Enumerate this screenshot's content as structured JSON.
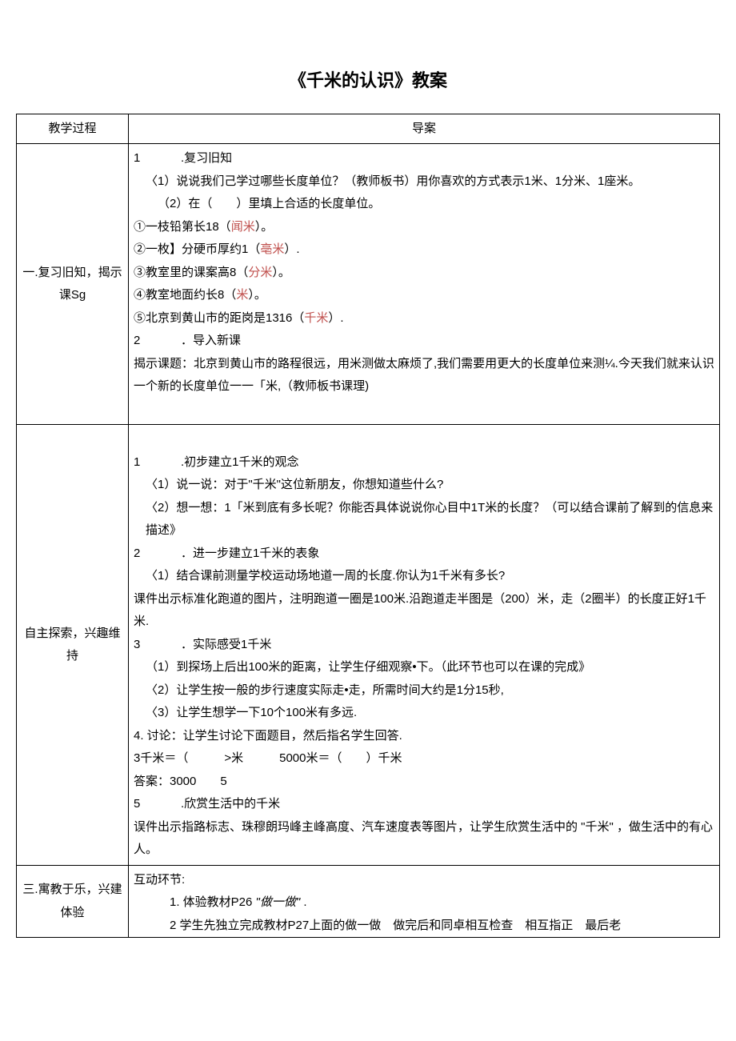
{
  "title": "《千米的认识》教案",
  "header": {
    "col1": "教学过程",
    "col2": "导案"
  },
  "rows": [
    {
      "label": "一.复习旧知，揭示课Sg",
      "content": {
        "s1_num": "1",
        "s1": ".复习旧知",
        "s1a": "〈1）说说我们己学过哪些长度单位？（教师板书）用你喜欢的方式表示1米、1分米、1座米。",
        "s1b": "（2）在（　　）里填上合适的长度单位。",
        "i1a": "①一枝铅第长18（",
        "i1u": "闻米",
        "i1b": "）。",
        "i2a": "②一枚】分硬币厚约1（",
        "i2u": "亳米",
        "i2b": "）.",
        "i3a": "③教室里的课案高8（",
        "i3u": "分米",
        "i3b": "）。",
        "i4a": "④教室地面约长8（",
        "i4u": "米",
        "i4b": "）。",
        "i5a": "⑤北京到黄山市的距岗是1316（",
        "i5u": "千米",
        "i5b": "）.",
        "s2_num": "2",
        "s2": "．导入新课",
        "s2a": "揭示课题：北京到黄山市的路程很远，用米测做太麻烦了,我们需要用更大的长度单位来测¼.今天我们就来认识一个新的长度单位一一「米,（教师板书课理)"
      }
    },
    {
      "label": "自主探索，兴趣维持",
      "content": {
        "s1_num": "1",
        "s1": ".初步建立1千米的观念",
        "s1a": "〈1）说一说：对于\"千米\"这位新朋友，你想知道些什么?",
        "s1b": "〈2）想一想：1「米到底有多长呢？你能否具体说说你心目中1T米的长度？（可以结合课前了解到的信息来描述》",
        "s2_num": "2",
        "s2": "．进一步建立1千米的表象",
        "s2a": "〈1）结合课前测量学校运动场地道一周的长度.你认为1千米有多长?",
        "s2b": "课件出示标准化跑道的图片，注明跑道一圈是100米.沿跑道走半图是（200）米，走（2圈半）的长度正好1千米.",
        "s3_num": "3",
        "s3": "．实际感受1千米",
        "s3a": "（1）到探场上后出100米的距离，让学生仔细观察•下。（此环节也可以在课的完成》",
        "s3b": "〈2）让学生按一般的步行速度实际走•走，所需时间大约是1分15秒,",
        "s3c": "〈3）让学生想学一下10个100米有多远.",
        "s4": "4. 讨论：让学生讨论下面题目，然后指名学生回答.",
        "s4a": "3千米＝（　　　>米　　　5000米＝（　　）千米",
        "s4b": "答案：3000　　5",
        "s5_num": "5",
        "s5": ".欣赏生活中的千米",
        "s5a": "误件出示指路标志、珠穆朗玛峰主峰高度、汽车速度表等图片，让学生欣赏生活中的 \"千米\" ，做生活中的有心人。"
      }
    },
    {
      "label": "三.寓教于乐，兴建体验",
      "content": {
        "h": "互动环节:",
        "a_pre": "1. 体验教材P26",
        "a_it": " \"做一做\" ",
        "a_post": ".",
        "b": "2 学生先独立完成教材P27上面的做一做　做完后和同卓相互检查　相互指正　最后老"
      }
    }
  ]
}
